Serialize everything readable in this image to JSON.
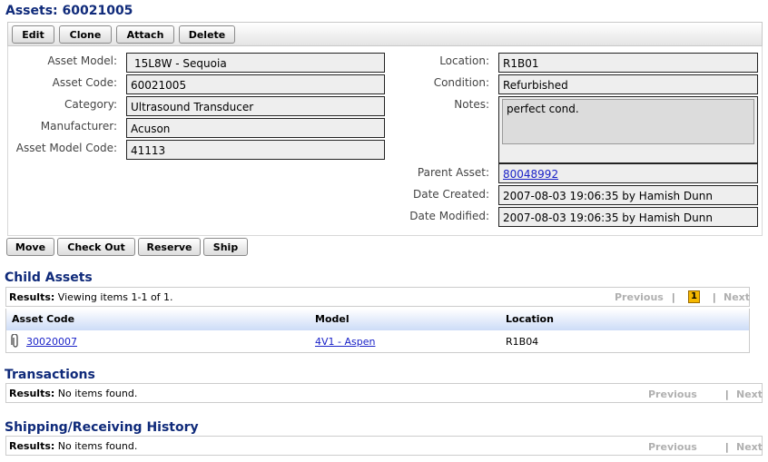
{
  "page": {
    "title": "Assets: 60021005"
  },
  "toolbar": {
    "edit": "Edit",
    "clone": "Clone",
    "attach": "Attach",
    "delete": "Delete"
  },
  "fields_left": [
    {
      "label": "Asset Model:",
      "value": "15L8W - Sequoia"
    },
    {
      "label": "Asset Code:",
      "value": "60021005"
    },
    {
      "label": "Category:",
      "value": "Ultrasound Transducer"
    },
    {
      "label": "Manufacturer:",
      "value": "Acuson"
    },
    {
      "label": "Asset Model Code:",
      "value": "41113"
    }
  ],
  "fields_right": {
    "location": {
      "label": "Location:",
      "value": "R1B01"
    },
    "condition": {
      "label": "Condition:",
      "value": "Refurbished"
    },
    "notes": {
      "label": "Notes:",
      "value": "perfect cond."
    },
    "parent_asset": {
      "label": "Parent Asset:",
      "value": "80048992"
    },
    "date_created": {
      "label": "Date Created:",
      "value": "2007-08-03 19:06:35 by Hamish Dunn"
    },
    "date_modified": {
      "label": "Date Modified:",
      "value": "2007-08-03 19:06:35 by Hamish Dunn"
    }
  },
  "actions": {
    "move": "Move",
    "check_out": "Check Out",
    "reserve": "Reserve",
    "ship": "Ship"
  },
  "child_assets": {
    "title": "Child Assets",
    "results_label": "Results:",
    "results_text": "Viewing items 1-1 of 1.",
    "previous": "Previous",
    "separator": "|",
    "current_page": "1",
    "next": "Next",
    "columns": [
      "Asset Code",
      "Model",
      "Location"
    ],
    "rows": [
      {
        "asset_code": "30020007",
        "model": "4V1 - Aspen",
        "location": "R1B04"
      }
    ]
  },
  "transactions": {
    "title": "Transactions",
    "results_label": "Results:",
    "results_text": "No items found.",
    "previous": "Previous",
    "separator": "|",
    "next": "Next"
  },
  "shipping": {
    "title": "Shipping/Receiving History",
    "results_label": "Results:",
    "results_text": "No items found.",
    "previous": "Previous",
    "separator": "|",
    "next": "Next"
  },
  "colors": {
    "heading": "#0f2a7a",
    "link": "#1a22c8",
    "active_page": "#f5b800",
    "table_header": "#cddcf7"
  },
  "icons": {
    "row_icon": "paperclip-icon"
  }
}
